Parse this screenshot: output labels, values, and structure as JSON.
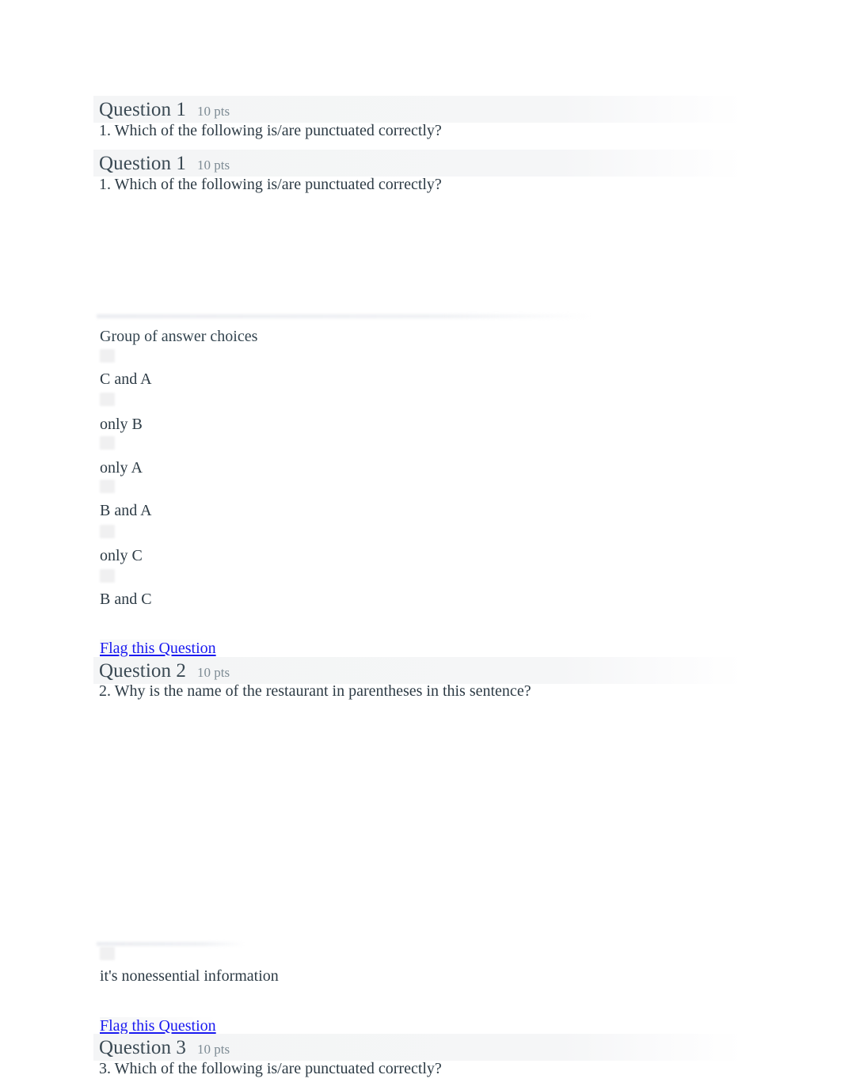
{
  "document": {
    "type": "quiz",
    "theme_colors": {
      "text": "#2d3b45",
      "heading": "#3b4a54",
      "points": "#7d8b94",
      "link": "#1a1af0",
      "banner": "#f4f5f6",
      "background": "#ffffff"
    }
  },
  "questions": [
    {
      "title": "Question 1",
      "points": "10 pts",
      "prompt": "1. Which of the following is/are punctuated correctly?"
    },
    {
      "title": "Question 1",
      "points": "10 pts",
      "prompt": "1. Which of the following is/are punctuated correctly?",
      "choices_label": "Group of answer choices",
      "choices": [
        "C and A",
        "only B",
        "only A",
        "B and A",
        "only C",
        "B and C"
      ],
      "flag_label": "Flag this Question"
    },
    {
      "title": "Question 2",
      "points": "10 pts",
      "prompt": "2. Why is the name of the restaurant in parentheses in this sentence?",
      "choices": [
        "it's nonessential information"
      ],
      "flag_label": "Flag this Question"
    },
    {
      "title": "Question 3",
      "points": "10 pts",
      "prompt": "3. Which of the following is/are punctuated correctly?"
    }
  ]
}
